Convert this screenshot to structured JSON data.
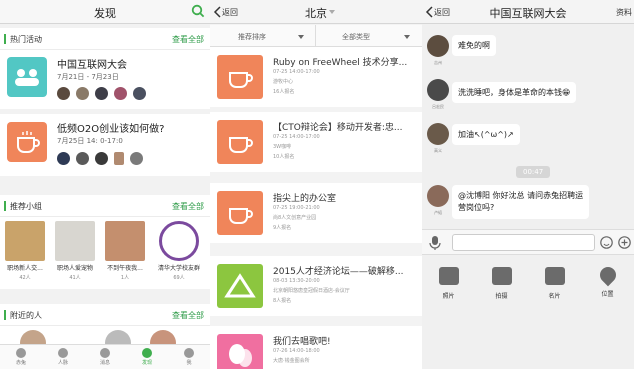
{
  "p1": {
    "title": "发现",
    "hot": {
      "label": "热门活动",
      "more": "查看全部"
    },
    "events": [
      {
        "title": "中国互联网大会",
        "date": "7月21日 - 7月23日"
      },
      {
        "title": "低频O2O创业该如何做?",
        "date": "7月25日 14: 0-17:0"
      }
    ],
    "groups": {
      "label": "推荐小组",
      "more": "查看全部",
      "items": [
        {
          "name": "职场新人交...",
          "count": "42人"
        },
        {
          "name": "职场人爱宠物",
          "count": "41人"
        },
        {
          "name": "不到午夜我...",
          "count": "1人"
        },
        {
          "name": "清华大学校友群",
          "count": "69人"
        }
      ]
    },
    "nearby": {
      "label": "附近的人",
      "more": "查看全部"
    },
    "tabs": [
      "赤兔",
      "人脉",
      "消息",
      "发现",
      "我"
    ]
  },
  "p2": {
    "back": "返回",
    "title": "北京",
    "filters": [
      "推荐排序",
      "全部类型"
    ],
    "events": [
      {
        "title": "Ruby on FreeWheel 技术分享...",
        "time": "07-25 14:00-17:00",
        "place": "游牧中心",
        "count": "16人报名"
      },
      {
        "title": "【CTO辩论会】移动开发者:忠...",
        "time": "07-25 14:00-17:00",
        "place": "3W咖啡",
        "count": "10人报名"
      },
      {
        "title": "指尖上的办公室",
        "time": "07-25 19:00-21:00",
        "place": "尚8人文创意产业园",
        "count": "9人报名"
      },
      {
        "title": "2015人才经济论坛——破解移...",
        "time": "08-03 13:30-20:00",
        "place": "北京朝阳悠唐皇冠假日酒店-会议厅",
        "count": "8人报名"
      },
      {
        "title": "我们去唱歌吧!",
        "time": "07-26 14:00-18:00",
        "place": "大唐·钱金图会所",
        "count": ""
      }
    ]
  },
  "p3": {
    "back": "返回",
    "title": "中国互联网大会",
    "right": "资料",
    "messages": [
      {
        "name": "吉州",
        "text": "难免的啊"
      },
      {
        "name": "吕宏民",
        "text": "洗洗睡吧，身体是革命的本钱😁"
      },
      {
        "name": "高义",
        "text": "加油↖(^ω^)↗"
      },
      {
        "name": "卢韬",
        "text": "@沈博阳 你好沈总 请问赤兔招聘运",
        "text2": "营岗位吗?"
      }
    ],
    "time": "00:47",
    "tools": [
      "照片",
      "拍摄",
      "名片",
      "位置"
    ]
  },
  "colors": {
    "green": "#3fae4e",
    "orange": "#f0855a",
    "teal": "#52c7c4"
  }
}
